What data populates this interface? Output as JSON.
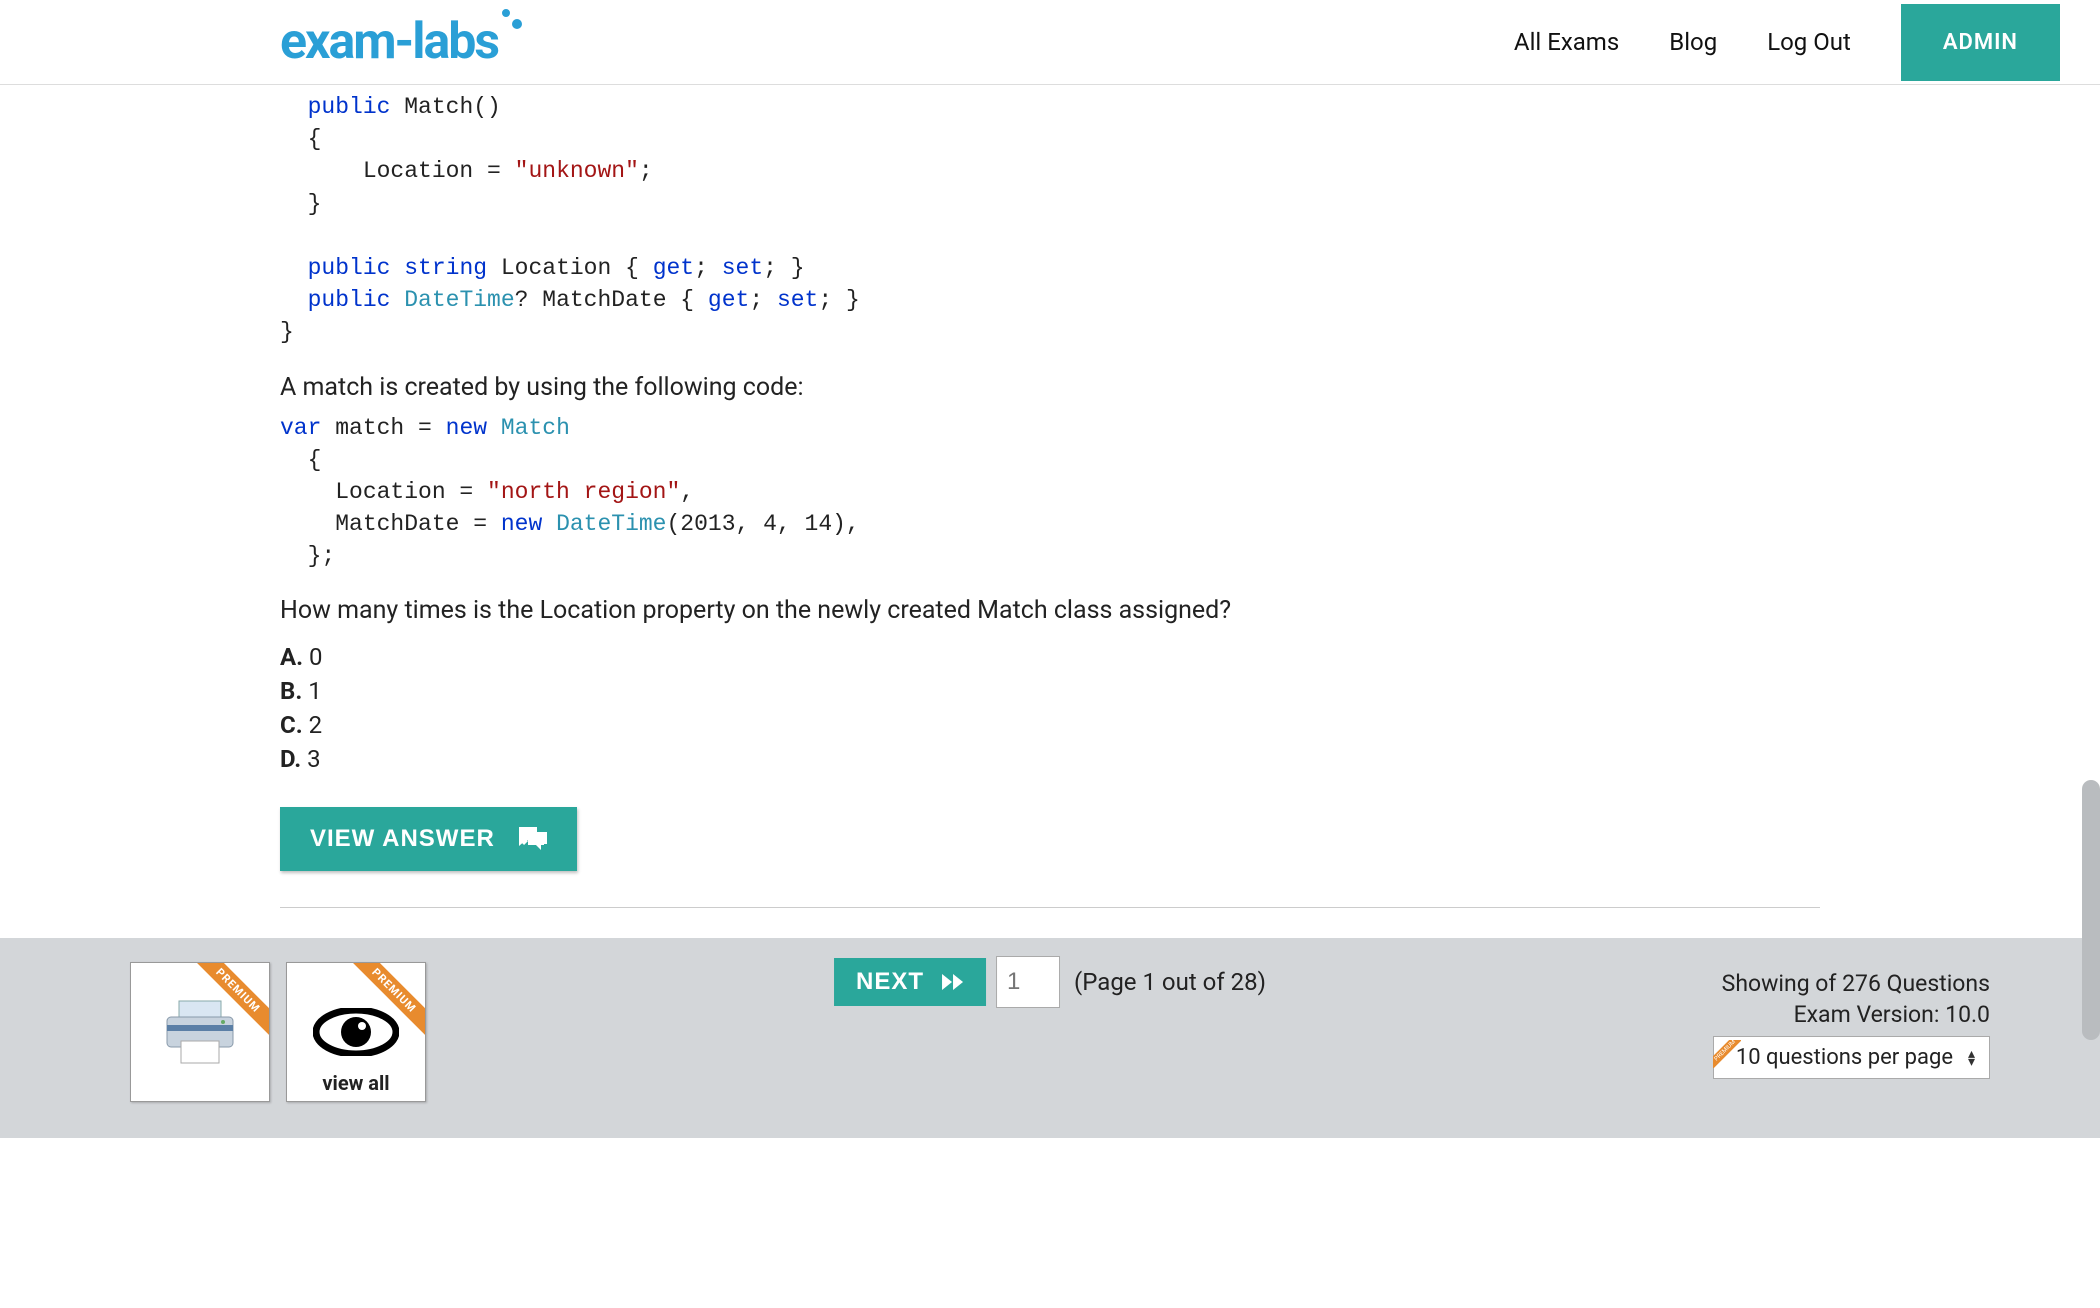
{
  "header": {
    "logo_text": "exam-labs",
    "nav": {
      "all_exams": "All Exams",
      "blog": "Blog",
      "logout": "Log Out",
      "admin": "ADMIN"
    }
  },
  "question": {
    "code1": {
      "l1a": "public",
      "l1b": " Match()",
      "l2": "{",
      "l3a": "    Location = ",
      "l3b": "\"unknown\"",
      "l3c": ";",
      "l4": "}",
      "l5a": "public",
      "l5b": " string",
      "l5c": " Location { ",
      "l5d": "get",
      "l5e": "; ",
      "l5f": "set",
      "l5g": "; }",
      "l6a": "public",
      "l6b": " DateTime",
      "l6c": "? MatchDate { ",
      "l6d": "get",
      "l6e": "; ",
      "l6f": "set",
      "l6g": "; }",
      "l7": "}"
    },
    "text_middle": "A match is created by using the following code:",
    "code2": {
      "l1a": "var",
      "l1b": " match = ",
      "l1c": "new",
      "l1d": " Match",
      "l2": "  {",
      "l3a": "    Location = ",
      "l3b": "\"north region\"",
      "l3c": ",",
      "l4a": "    MatchDate = ",
      "l4b": "new",
      "l4c": " DateTime",
      "l4d": "(2013, 4, 14),",
      "l5": "  };"
    },
    "text_question": "How many times is the Location property on the newly created Match class assigned?",
    "options": [
      {
        "letter": "A.",
        "text": " 0"
      },
      {
        "letter": "B.",
        "text": " 1"
      },
      {
        "letter": "C.",
        "text": " 2"
      },
      {
        "letter": "D.",
        "text": " 3"
      }
    ],
    "view_answer": "VIEW ANSWER"
  },
  "footer": {
    "premium_label": "PREMIUM",
    "view_all": "view all",
    "next": "NEXT",
    "page_input_placeholder": "1",
    "page_info": "(Page 1 out of 28)",
    "showing": "Showing of 276 Questions",
    "exam_version": "Exam Version: 10.0",
    "per_page": "10 questions per page"
  }
}
